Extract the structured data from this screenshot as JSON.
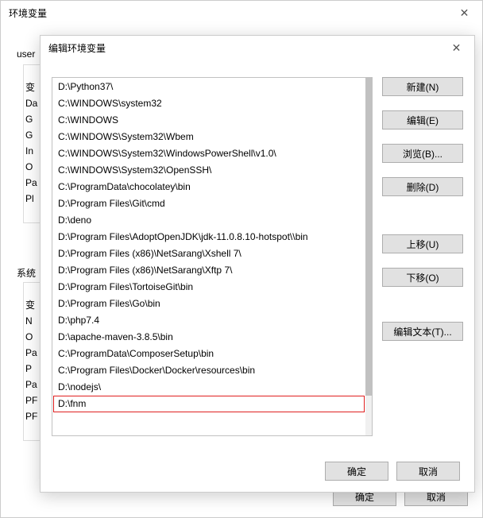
{
  "outer": {
    "title": "环境变量",
    "user_label": "user",
    "user_cols": [
      "变",
      "Da",
      "G",
      "G",
      "In",
      "O",
      "Pa",
      "Pl"
    ],
    "sys_label": "系统",
    "sys_cols": [
      "变",
      "N",
      "O",
      "Pa",
      "P",
      "Pa",
      "PF",
      "PF"
    ],
    "buttons": {
      "ok": "确定",
      "cancel": "取消"
    }
  },
  "inner": {
    "title": "编辑环境变量",
    "paths": [
      "D:\\Python37\\",
      "C:\\WINDOWS\\system32",
      "C:\\WINDOWS",
      "C:\\WINDOWS\\System32\\Wbem",
      "C:\\WINDOWS\\System32\\WindowsPowerShell\\v1.0\\",
      "C:\\WINDOWS\\System32\\OpenSSH\\",
      "C:\\ProgramData\\chocolatey\\bin",
      "D:\\Program Files\\Git\\cmd",
      "D:\\deno",
      "D:\\Program Files\\AdoptOpenJDK\\jdk-11.0.8.10-hotspot\\\\bin",
      "D:\\Program Files (x86)\\NetSarang\\Xshell 7\\",
      "D:\\Program Files (x86)\\NetSarang\\Xftp 7\\",
      "D:\\Program Files\\TortoiseGit\\bin",
      "D:\\Program Files\\Go\\bin",
      "D:\\php7.4",
      "D:\\apache-maven-3.8.5\\bin",
      "C:\\ProgramData\\ComposerSetup\\bin",
      "C:\\Program Files\\Docker\\Docker\\resources\\bin",
      "D:\\nodejs\\",
      "D:\\fnm"
    ],
    "highlight_index": 19,
    "buttons": {
      "new": "新建(N)",
      "edit": "编辑(E)",
      "browse": "浏览(B)...",
      "delete": "删除(D)",
      "moveup": "上移(U)",
      "movedown": "下移(O)",
      "edittext": "编辑文本(T)...",
      "ok": "确定",
      "cancel": "取消"
    }
  }
}
